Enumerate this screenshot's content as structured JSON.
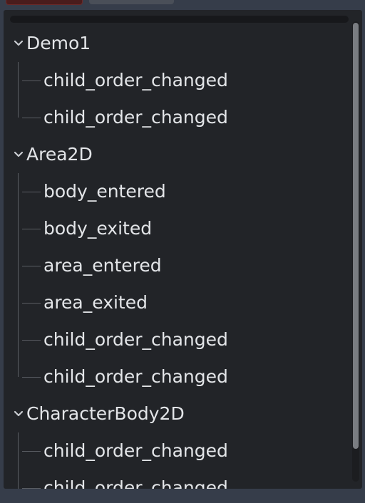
{
  "tree": {
    "groups": [
      {
        "label": "Demo1",
        "expanded": true,
        "children": [
          "child_order_changed",
          "child_order_changed"
        ]
      },
      {
        "label": "Area2D",
        "expanded": true,
        "children": [
          "body_entered",
          "body_exited",
          "area_entered",
          "area_exited",
          "child_order_changed",
          "child_order_changed"
        ]
      },
      {
        "label": "CharacterBody2D",
        "expanded": true,
        "children": [
          "child_order_changed",
          "child_order_changed"
        ]
      }
    ]
  },
  "icons": {
    "expand": "chevron-down-icon"
  },
  "colors": {
    "panel_bg": "#222428",
    "chrome_bg": "#363d4a",
    "text": "#e3e5e8",
    "guide": "#5a5d63",
    "scroll_thumb": "#7a7d82"
  }
}
